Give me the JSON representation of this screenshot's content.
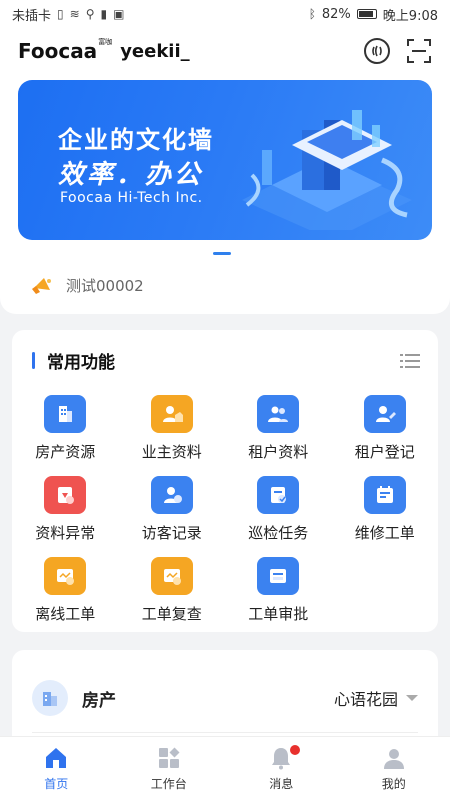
{
  "status_bar": {
    "carrier": "未插卡",
    "battery": "82%",
    "time": "晚上9:08"
  },
  "header": {
    "logo": "Foocaa",
    "logo_sup": "富咖",
    "username": "yeekii_"
  },
  "banner": {
    "title": "企业的文化墙",
    "subtitle": "效率．办公",
    "company": "Foocaa Hi-Tech Inc."
  },
  "notice": {
    "text": "测试00002"
  },
  "functions": {
    "title": "常用功能",
    "items": [
      {
        "label": "房产资源",
        "color": "#3b82f0",
        "icon": "building-icon"
      },
      {
        "label": "业主资料",
        "color": "#f5a623",
        "icon": "owner-icon"
      },
      {
        "label": "租户资料",
        "color": "#3b82f0",
        "icon": "tenants-icon"
      },
      {
        "label": "租户登记",
        "color": "#3b82f0",
        "icon": "register-icon"
      },
      {
        "label": "资料异常",
        "color": "#ef5350",
        "icon": "alert-doc-icon"
      },
      {
        "label": "访客记录",
        "color": "#3b82f0",
        "icon": "visitor-icon"
      },
      {
        "label": "巡检任务",
        "color": "#3b82f0",
        "icon": "inspection-icon"
      },
      {
        "label": "维修工单",
        "color": "#3b82f0",
        "icon": "repair-icon"
      },
      {
        "label": "离线工单",
        "color": "#f5a623",
        "icon": "offline-icon"
      },
      {
        "label": "工单复查",
        "color": "#f5a623",
        "icon": "review-icon"
      },
      {
        "label": "工单审批",
        "color": "#3b82f0",
        "icon": "approve-icon"
      }
    ]
  },
  "property": {
    "label": "房产",
    "value": "心语花园"
  },
  "nav": {
    "items": [
      {
        "label": "首页",
        "active": true
      },
      {
        "label": "工作台",
        "active": false
      },
      {
        "label": "消息",
        "active": false
      },
      {
        "label": "我的",
        "active": false
      }
    ]
  }
}
